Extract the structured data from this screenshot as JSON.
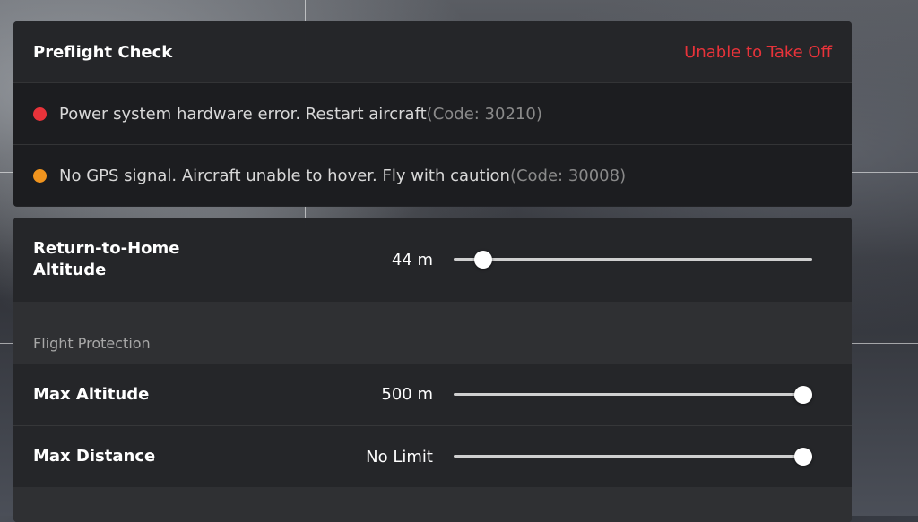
{
  "preflight": {
    "title": "Preflight Check",
    "status": "Unable to Take Off",
    "status_color": "#e8333a",
    "items": [
      {
        "severity": "error",
        "color": "#e8333a",
        "message": "Power system hardware error. Restart aircraft",
        "code": "(Code: 30210)"
      },
      {
        "severity": "warning",
        "color": "#f0941e",
        "message": "No GPS signal. Aircraft unable to hover. Fly with caution",
        "code": "(Code: 30008)"
      }
    ]
  },
  "settings": {
    "rth_altitude": {
      "label": "Return-to-Home Altitude",
      "value": "44 m",
      "slider_fraction": 0.06
    },
    "section_label": "Flight Protection",
    "max_altitude": {
      "label": "Max Altitude",
      "value": "500 m",
      "slider_fraction": 1.0
    },
    "max_distance": {
      "label": "Max Distance",
      "value": "No Limit",
      "slider_fraction": 1.0
    }
  }
}
